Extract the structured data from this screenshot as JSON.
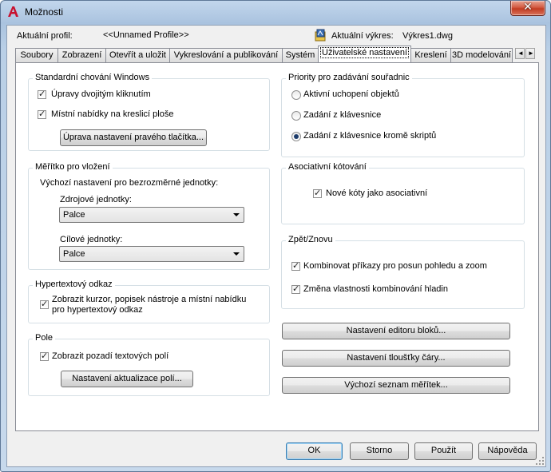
{
  "window": {
    "title": "Možnosti",
    "close_glyph": "✕"
  },
  "header": {
    "profile_label": "Aktuální profil:",
    "profile_value": "<<Unnamed Profile>>",
    "drawing_label": "Aktuální výkres:",
    "drawing_value": "Výkres1.dwg"
  },
  "tabs": [
    {
      "label": "Soubory"
    },
    {
      "label": "Zobrazení"
    },
    {
      "label": "Otevřít a uložit"
    },
    {
      "label": "Vykreslování a publikování"
    },
    {
      "label": "Systém"
    },
    {
      "label": "Uživatelské nastavení",
      "active": true
    },
    {
      "label": "Kreslení"
    },
    {
      "label": "3D modelování"
    }
  ],
  "windows_behavior": {
    "title": "Standardní chování Windows",
    "dblclick_label": "Úpravy dvojitým kliknutím",
    "dblclick_checked": true,
    "shortcut_label": "Místní nabídky na kreslicí ploše",
    "shortcut_checked": true,
    "rightclick_button": "Úprava nastavení pravého tlačítka..."
  },
  "insertion_scale": {
    "title": "Měřítko pro vložení",
    "desc": "Výchozí nastavení pro bezrozměrné jednotky:",
    "source_label": "Zdrojové jednotky:",
    "source_value": "Palce",
    "target_label": "Cílové jednotky:",
    "target_value": "Palce"
  },
  "hyperlink": {
    "title": "Hypertextový odkaz",
    "line1": "Zobrazit kurzor, popisek nástroje a místní nabídku",
    "line2": "pro hypertextový odkaz",
    "checked": true
  },
  "fields": {
    "title": "Pole",
    "background_label": "Zobrazit pozadí textových polí",
    "background_checked": true,
    "update_button": "Nastavení aktualizace polí..."
  },
  "coordinate_priority": {
    "title": "Priority pro zadávání souřadnic",
    "options": [
      "Aktivní uchopení objektů",
      "Zadání z klávesnice",
      "Zadání z klávesnice kromě skriptů"
    ],
    "selected_index": 2
  },
  "associative_dim": {
    "title": "Asociativní kótování",
    "label": "Nové kóty jako asociativní",
    "checked": true
  },
  "undo_redo": {
    "title": "Zpět/Znovu",
    "combine_zoom_label": "Kombinovat příkazy pro posun pohledu a zoom",
    "combine_zoom_checked": true,
    "layer_label": "Změna vlastnosti kombinování hladin",
    "layer_checked": true
  },
  "buttons_right": {
    "block_editor": "Nastavení editoru bloků...",
    "lineweight": "Nastavení tloušťky čáry...",
    "scale_list": "Výchozí seznam měřítek..."
  },
  "footer": {
    "ok": "OK",
    "cancel": "Storno",
    "apply": "Použít",
    "help": "Nápověda"
  },
  "icons": {
    "checkmark": "✓",
    "left_arrow": "◄",
    "right_arrow": "►"
  },
  "colors": {
    "app_icon_red": "#c8102e",
    "radio_dot": "#1d3c6b"
  }
}
